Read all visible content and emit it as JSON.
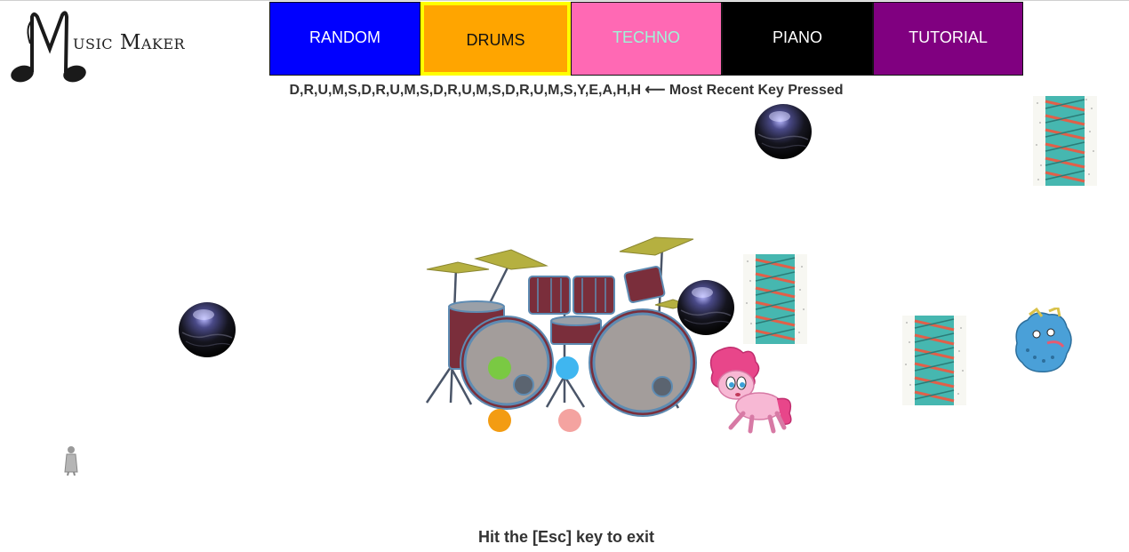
{
  "app": {
    "logo_text": "usic Maker"
  },
  "nav": {
    "random": "RANDOM",
    "drums": "DRUMS",
    "techno": "TECHNO",
    "piano": "PIANO",
    "tutorial": "TUTORIAL"
  },
  "status": {
    "keys_pressed": "D,R,U,M,S,D,R,U,M,S,D,R,U,M,S,D,R,U,M,S,Y,E,A,H,H",
    "arrow": "⟵",
    "keys_label": "Most Recent Key Pressed"
  },
  "footer": {
    "hint_prefix": "Hit the ",
    "hint_key": "[Esc]",
    "hint_suffix": " key to exit"
  },
  "colors": {
    "random_bg": "#0000ff",
    "drums_bg": "#ffa500",
    "drums_border": "#ffff00",
    "techno_bg": "#ff69b4",
    "techno_text": "#9ff5d8",
    "piano_bg": "#000000",
    "tutorial_bg": "#800080",
    "drum_pad_green": "#7ac943",
    "drum_pad_blue": "#3fb6f0",
    "drum_pad_orange": "#f39c12",
    "drum_pad_pink": "#f4a3a0"
  },
  "sprites": [
    "dark-orb-image",
    "dna-helix-image",
    "drum-kit-image",
    "pink-pony-image",
    "blue-dragon-image",
    "small-figure-image"
  ]
}
